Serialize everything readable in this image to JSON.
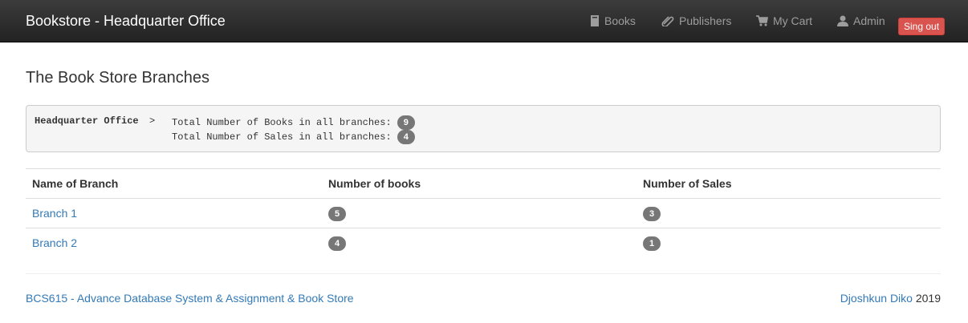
{
  "navbar": {
    "brand": "Bookstore - Headquarter Office",
    "items": [
      {
        "label": "Books",
        "icon": "book-icon"
      },
      {
        "label": "Publishers",
        "icon": "paperclip-icon"
      },
      {
        "label": "My Cart",
        "icon": "cart-icon"
      },
      {
        "label": "Admin",
        "icon": "user-icon"
      }
    ],
    "signout_label": "Sing out"
  },
  "page": {
    "title": "The Book Store Branches"
  },
  "summary": {
    "office": "Headquarter Office",
    "arrow": ">",
    "books_label": "Total Number of Books in all branches:",
    "books_value": "9",
    "sales_label": "Total Number of Sales in all branches:",
    "sales_value": "4"
  },
  "table": {
    "headers": [
      "Name of Branch",
      "Number of books",
      "Number of Sales"
    ],
    "rows": [
      {
        "branch": "Branch 1",
        "books": "5",
        "sales": "3"
      },
      {
        "branch": "Branch 2",
        "books": "4",
        "sales": "1"
      }
    ]
  },
  "footer": {
    "left": "BCS615 - Advance Database System & Assignment & Book Store",
    "author": "Djoshkun Diko",
    "year": "2019"
  },
  "colors": {
    "navbar": "#222222",
    "link": "#337ab7",
    "signout": "#d9534f",
    "badge": "#777777"
  }
}
